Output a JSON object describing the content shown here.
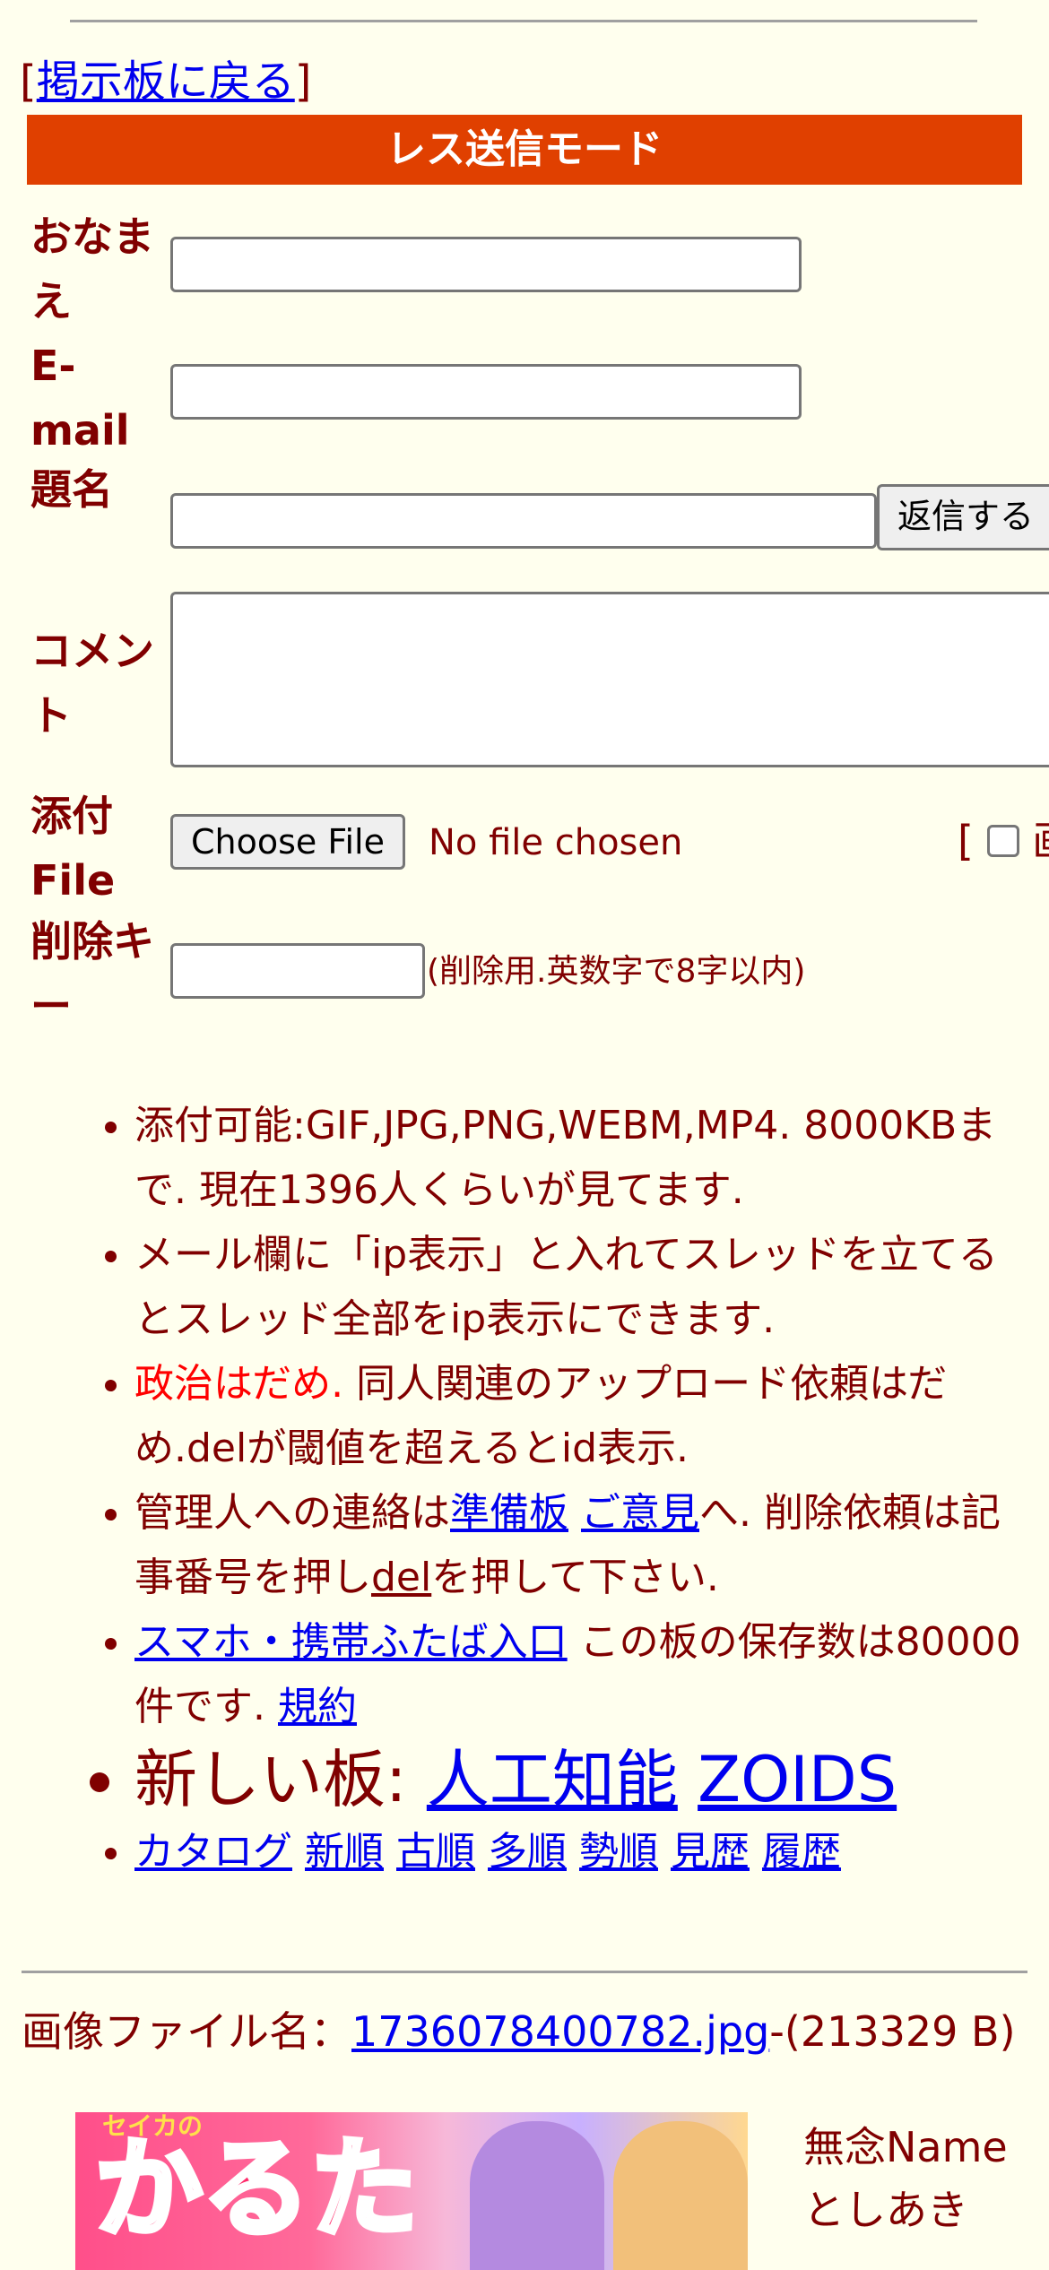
{
  "nav": {
    "back_open": "[",
    "back_label": "掲示板に戻る",
    "back_close": "]"
  },
  "form": {
    "mode_title": "レス送信モード",
    "name_label": "おなまえ",
    "email_label": "E-mail",
    "subject_label": "題名",
    "comment_label": "コメント",
    "file_label": "添付File",
    "delkey_label": "削除キー",
    "submit_label": "返信する",
    "choose_file_label": "Choose File",
    "no_file_text": "No file chosen",
    "image_toggle_open": "[",
    "image_toggle_label": "画",
    "delkey_hint": "(削除用.英数字で8字以内)"
  },
  "rules": {
    "r1": "添付可能:GIF,JPG,PNG,WEBM,MP4. 8000KBまで. 現在1396人くらいが見てます.",
    "r2": "メール欄に「ip表示」と入れてスレッドを立てるとスレッド全部をip表示にできます.",
    "r3_red": "政治はだめ.",
    "r3_rest": " 同人関連のアップロード依頼はだめ.delが閾値を超えるとid表示.",
    "r4_a": "管理人への連絡は",
    "r4_link1": "準備板",
    "r4_link2": "ご意見",
    "r4_b": "へ. 削除依頼は記事番号を押し",
    "r4_del": "del",
    "r4_c": "を押して下さい.",
    "r5_link": "スマホ・携帯ふたば入口",
    "r5_text": " この板の保存数は80000件です. ",
    "r5_terms": "規約",
    "r6_label": "新しい板: ",
    "r6_link1": "人工知能",
    "r6_link2": "ZOIDS",
    "sort_links": [
      "カタログ",
      "新順",
      "古順",
      "多順",
      "勢順",
      "見歴",
      "履歴"
    ]
  },
  "post": {
    "file_prefix": "画像ファイル名：",
    "file_name": "1736078400782.jpg",
    "file_size": "-(213329 B)",
    "thumb_text": "かるた",
    "thumb_small": "セイカの",
    "name": "無念Name",
    "author": "としあき"
  }
}
